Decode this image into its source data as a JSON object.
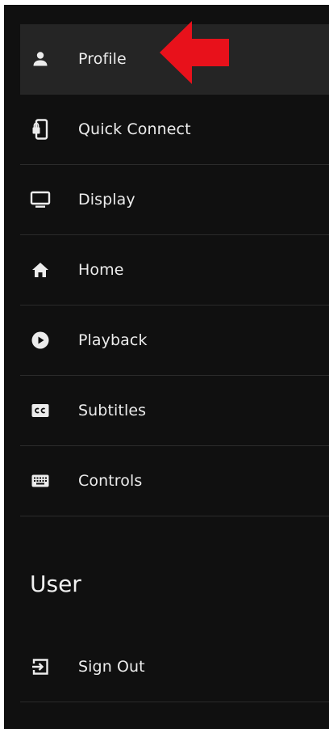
{
  "settings_menu": {
    "items": [
      {
        "label": "Profile",
        "icon": "person-icon"
      },
      {
        "label": "Quick Connect",
        "icon": "device-lock-icon"
      },
      {
        "label": "Display",
        "icon": "monitor-icon"
      },
      {
        "label": "Home",
        "icon": "home-icon"
      },
      {
        "label": "Playback",
        "icon": "play-circle-icon"
      },
      {
        "label": "Subtitles",
        "icon": "closed-captions-icon"
      },
      {
        "label": "Controls",
        "icon": "keyboard-icon"
      }
    ]
  },
  "user_section": {
    "title": "User",
    "items": [
      {
        "label": "Sign Out",
        "icon": "sign-out-icon"
      }
    ]
  },
  "annotation": {
    "arrow_color": "#e8111b",
    "points_to": "Profile"
  },
  "colors": {
    "panel_bg": "#101010",
    "active_row_bg": "#252525",
    "text": "#ececec",
    "divider": "#2b2b2b"
  }
}
